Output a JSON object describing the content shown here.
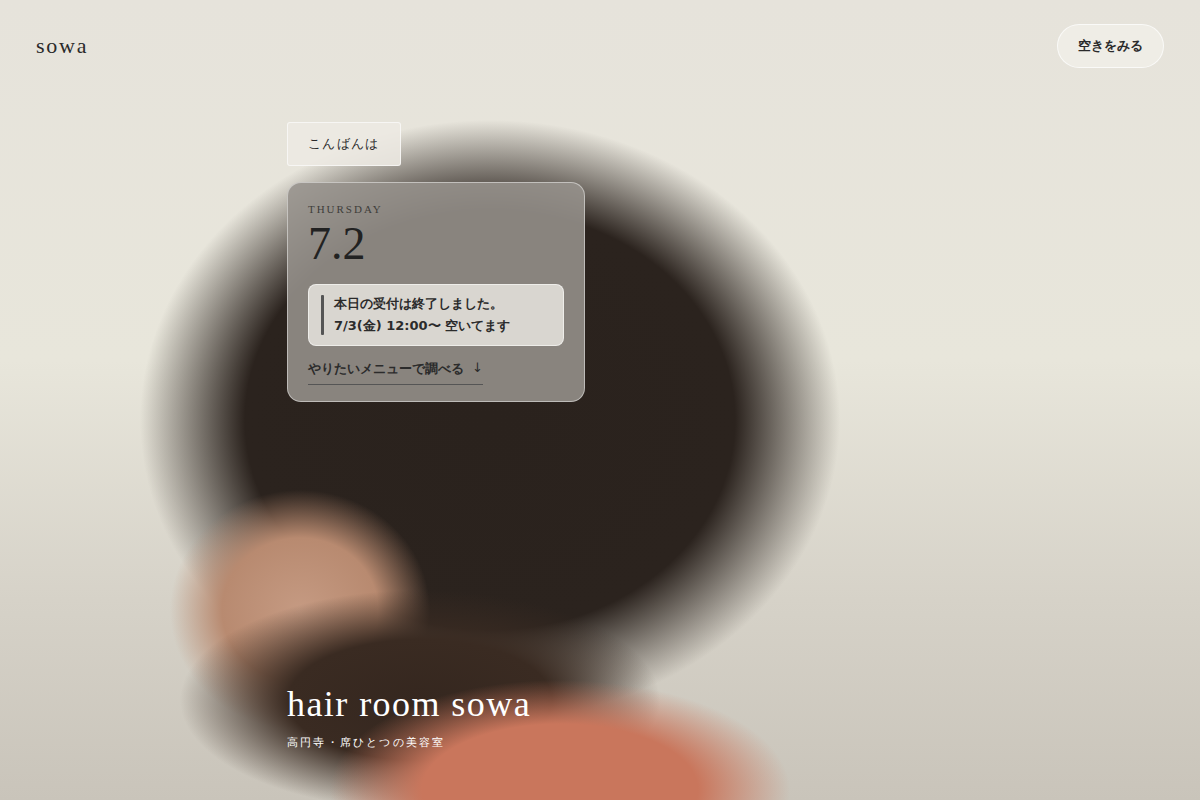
{
  "header": {
    "logo": "sowa",
    "cta": "空きをみる"
  },
  "greeting": "こんばんは",
  "date_card": {
    "weekday": "THURSDAY",
    "date": "7.2",
    "notice": {
      "lines": [
        "本日の受付は終了しました。",
        "7/3(金) 12:00〜 空いてます"
      ]
    },
    "link": {
      "label": "やりたいメニューで調べる",
      "arrow": "↓"
    }
  },
  "hero": {
    "title": "hair room sowa",
    "subtitle": "高円寺・席ひとつの美容室"
  }
}
